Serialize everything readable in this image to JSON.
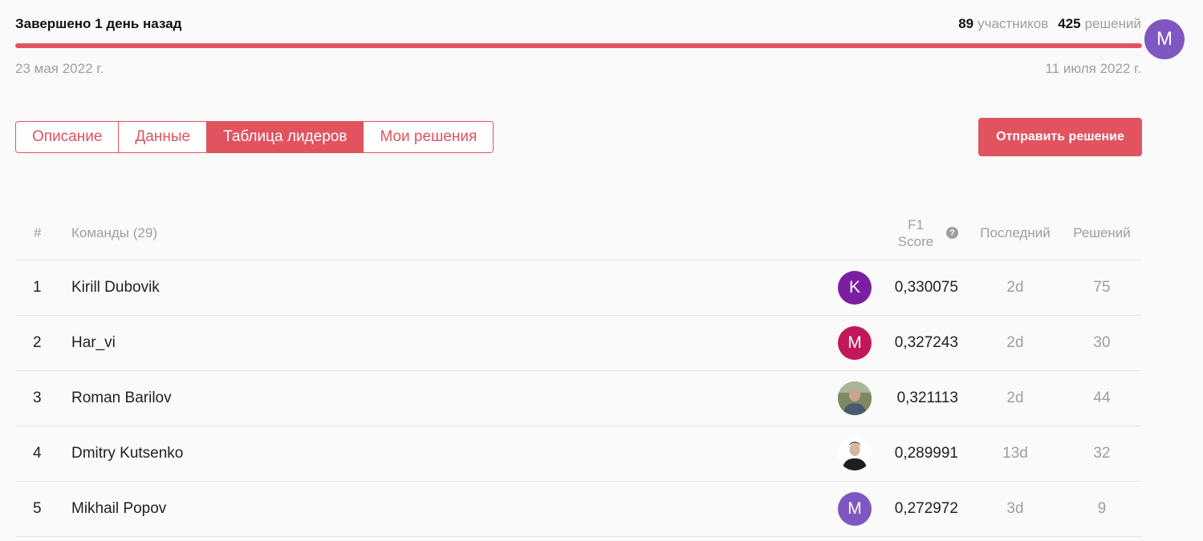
{
  "header": {
    "status": "Завершено 1 день назад",
    "participants_count": "89",
    "participants_label": "участников",
    "solutions_count": "425",
    "solutions_label": "решений",
    "start_date": "23 мая 2022 г.",
    "end_date": "11 июля 2022 г.",
    "progress": 1.0,
    "progress_color": "#e0535f"
  },
  "user": {
    "avatar_letter": "M",
    "avatar_color": "#7e57c2"
  },
  "tabs": [
    {
      "label": "Описание",
      "active": false
    },
    {
      "label": "Данные",
      "active": false
    },
    {
      "label": "Таблица лидеров",
      "active": true
    },
    {
      "label": "Мои решения",
      "active": false
    }
  ],
  "submit_button": {
    "label": "Отправить решение"
  },
  "leaderboard": {
    "columns": {
      "rank": "#",
      "teams": "Команды (29)",
      "score_line1": "F1",
      "score_line2": "Score",
      "score_help_icon": "question-circle-icon",
      "last": "Последний",
      "submissions": "Решений"
    },
    "rows": [
      {
        "rank": "1",
        "team": "Kirill Dubovik",
        "avatar_letter": "K",
        "avatar_color": "#7b1fa2",
        "avatar_type": "letter",
        "score": "0,330075",
        "last": "2d",
        "submissions": "75"
      },
      {
        "rank": "2",
        "team": "Har_vi",
        "avatar_letter": "M",
        "avatar_color": "#c2185b",
        "avatar_type": "letter",
        "score": "0,327243",
        "last": "2d",
        "submissions": "30"
      },
      {
        "rank": "3",
        "team": "Roman Barilov",
        "avatar_letter": "",
        "avatar_color": "#6d7a5a",
        "avatar_type": "photo-outdoor",
        "score": "0,321113",
        "last": "2d",
        "submissions": "44"
      },
      {
        "rank": "4",
        "team": "Dmitry Kutsenko",
        "avatar_letter": "",
        "avatar_color": "#ffffff",
        "avatar_type": "photo-portrait",
        "score": "0,289991",
        "last": "13d",
        "submissions": "32"
      },
      {
        "rank": "5",
        "team": "Mikhail Popov",
        "avatar_letter": "M",
        "avatar_color": "#7e57c2",
        "avatar_type": "letter",
        "score": "0,272972",
        "last": "3d",
        "submissions": "9"
      }
    ]
  }
}
